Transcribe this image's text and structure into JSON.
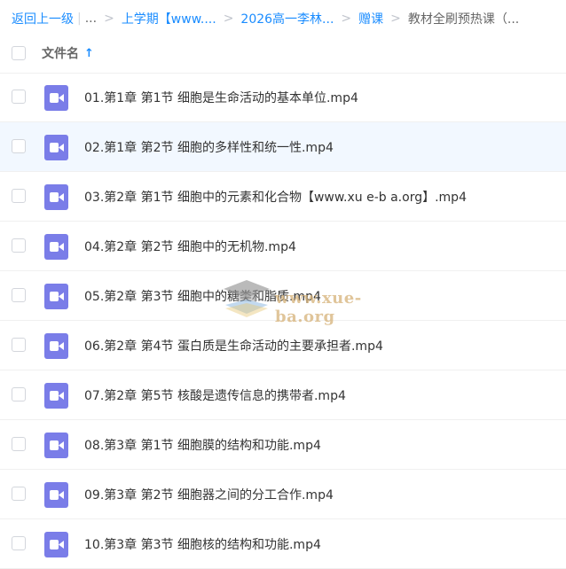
{
  "breadcrumb": {
    "back": "返回上一级",
    "ellipsis": "...",
    "items": [
      "上学期【www....",
      "2026高一李林...",
      "赠课"
    ],
    "current": "教材全刷预热课（..."
  },
  "header": {
    "column_name": "文件名",
    "sort_icon": "↑"
  },
  "files": [
    {
      "name": "01.第1章 第1节 细胞是生命活动的基本单位.mp4"
    },
    {
      "name": "02.第1章 第2节 细胞的多样性和统一性.mp4"
    },
    {
      "name": "03.第2章 第1节 细胞中的元素和化合物【www.xu e-b a.org】.mp4"
    },
    {
      "name": "04.第2章 第2节 细胞中的无机物.mp4"
    },
    {
      "name": "05.第2章 第3节 细胞中的糖类和脂质.mp4"
    },
    {
      "name": "06.第2章 第4节 蛋白质是生命活动的主要承担者.mp4"
    },
    {
      "name": "07.第2章 第5节 核酸是遗传信息的携带者.mp4"
    },
    {
      "name": "08.第3章 第1节 细胞膜的结构和功能.mp4"
    },
    {
      "name": "09.第3章 第2节 细胞器之间的分工合作.mp4"
    },
    {
      "name": "10.第3章 第3节 细胞核的结构和功能.mp4"
    }
  ],
  "watermark": {
    "text": "www.xue-ba.org"
  },
  "colors": {
    "link": "#1a8cff",
    "video_icon": "#7a7de8",
    "hover_row": "#f2f8ff"
  }
}
